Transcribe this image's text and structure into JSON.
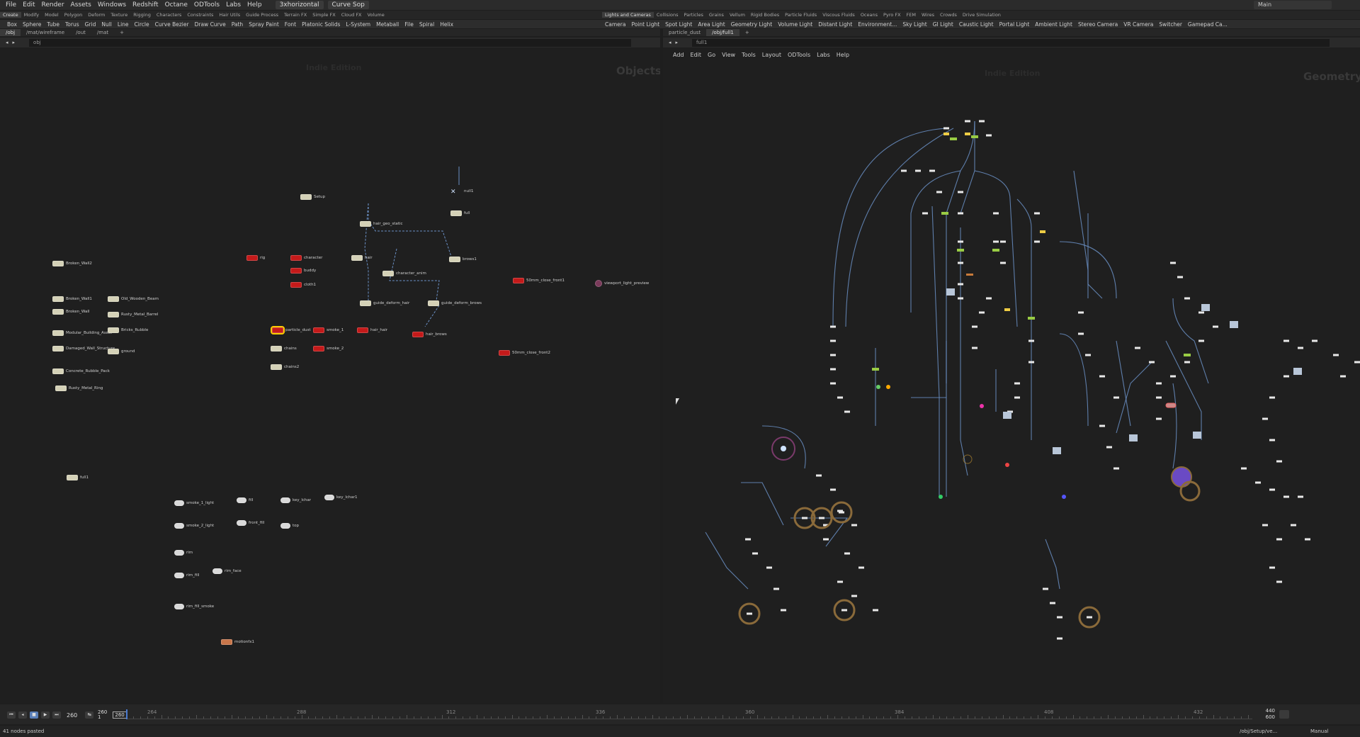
{
  "menubar": {
    "items": [
      "File",
      "Edit",
      "Render",
      "Assets",
      "Windows",
      "Redshift",
      "Octane",
      "ODTools",
      "Labs",
      "Help"
    ],
    "desktop": "3xhorizontal",
    "context": "Curve Sop",
    "main_workspace": "Main"
  },
  "shelf": {
    "tabs_left": [
      "Create",
      "Modify",
      "Model",
      "Polygon",
      "Deform",
      "Texture",
      "Rigging",
      "Characters",
      "Constraints",
      "Hair Utils",
      "Guide Process",
      "Terrain FX",
      "Simple FX",
      "Cloud FX",
      "Volume"
    ],
    "tabs_right": [
      "Lights and Cameras",
      "Collisions",
      "Particles",
      "Grains",
      "Vellum",
      "Rigid Bodies",
      "Particle Fluids",
      "Viscous Fluids",
      "Oceans",
      "Pyro FX",
      "FEM",
      "Wires",
      "Crowds",
      "Drive Simulation"
    ],
    "tools_left": [
      "Box",
      "Sphere",
      "Tube",
      "Torus",
      "Grid",
      "Null",
      "Line",
      "Circle",
      "Curve Bezier",
      "Draw Curve",
      "Path",
      "Spray Paint",
      "Font",
      "Platonic Solids",
      "L-System",
      "Metaball",
      "File",
      "Spiral",
      "Helix"
    ],
    "tools_right": [
      "Camera",
      "Point Light",
      "Spot Light",
      "Area Light",
      "Geometry Light",
      "Volume Light",
      "Distant Light",
      "Environment...",
      "Sky Light",
      "GI Light",
      "Caustic Light",
      "Portal Light",
      "Ambient Light",
      "Stereo Camera",
      "VR Camera",
      "Switcher",
      "Gamepad Ca..."
    ]
  },
  "left_pane": {
    "tabs": [
      "/obj",
      "/mat/wireframe",
      "/out",
      "/mat"
    ],
    "path": "obj",
    "watermark": "Indie Edition",
    "context_label": "Objects",
    "nodes": [
      {
        "label": "Setup",
        "type": "geo"
      },
      {
        "label": "null1",
        "type": "null"
      },
      {
        "label": "full",
        "type": "geo"
      },
      {
        "label": "hair_geo_static",
        "type": "geo"
      },
      {
        "label": "Broken_Wall2",
        "type": "geo"
      },
      {
        "label": "rig",
        "type": "red"
      },
      {
        "label": "character",
        "type": "red"
      },
      {
        "label": "buddy",
        "type": "red"
      },
      {
        "label": "cloth1",
        "type": "red"
      },
      {
        "label": "hair",
        "type": "geo"
      },
      {
        "label": "character_anim",
        "type": "geo"
      },
      {
        "label": "brows1",
        "type": "geo"
      },
      {
        "label": "50mm_close_front1",
        "type": "red"
      },
      {
        "label": "viewport_light_preview",
        "type": "light"
      },
      {
        "label": "Broken_Wall1",
        "type": "geo"
      },
      {
        "label": "Old_Wooden_Beam",
        "type": "geo"
      },
      {
        "label": "Broken_Wall",
        "type": "geo"
      },
      {
        "label": "Rusty_Metal_Barrel",
        "type": "geo"
      },
      {
        "label": "guide_deform_hair",
        "type": "geo"
      },
      {
        "label": "guide_deform_brows",
        "type": "geo"
      },
      {
        "label": "Modular_Building_Asset",
        "type": "geo"
      },
      {
        "label": "Bricks_Rubble",
        "type": "geo"
      },
      {
        "label": "particle_dust",
        "type": "red"
      },
      {
        "label": "smoke_1",
        "type": "red"
      },
      {
        "label": "hair_hair",
        "type": "red"
      },
      {
        "label": "hair_brows",
        "type": "red"
      },
      {
        "label": "Damaged_Wall_Structure",
        "type": "geo"
      },
      {
        "label": "ground",
        "type": "geo"
      },
      {
        "label": "chains",
        "type": "geo"
      },
      {
        "label": "smoke_2",
        "type": "red"
      },
      {
        "label": "50mm_close_front2",
        "type": "red"
      },
      {
        "label": "chains2",
        "type": "geo"
      },
      {
        "label": "Concrete_Rubble_Pack",
        "type": "geo"
      },
      {
        "label": "Rusty_Metal_Ring",
        "type": "geo"
      },
      {
        "label": "full1",
        "type": "geo"
      },
      {
        "label": "smoke_1_light",
        "type": "light"
      },
      {
        "label": "fill",
        "type": "light"
      },
      {
        "label": "key_lchar",
        "type": "light"
      },
      {
        "label": "key_lchar1",
        "type": "light"
      },
      {
        "label": "smoke_2_light",
        "type": "light"
      },
      {
        "label": "front_fill",
        "type": "light"
      },
      {
        "label": "top",
        "type": "light"
      },
      {
        "label": "rim",
        "type": "light"
      },
      {
        "label": "rim_fill",
        "type": "light"
      },
      {
        "label": "rim_face",
        "type": "light"
      },
      {
        "label": "rim_fill_smoke",
        "type": "light"
      },
      {
        "label": "motionfx1",
        "type": "orange"
      }
    ]
  },
  "right_pane": {
    "tabs": [
      "particle_dust",
      "/obj/full1"
    ],
    "path": "full1",
    "menu": [
      "Add",
      "Edit",
      "Go",
      "View",
      "Tools",
      "Layout",
      "ODTools",
      "Labs",
      "Help"
    ],
    "watermark": "Indie Edition",
    "context_label": "Geometry"
  },
  "timeline": {
    "current_frame": "260",
    "frame_field": "260",
    "range_start": "260",
    "range_step": "1",
    "ticks": [
      "264",
      "288",
      "312",
      "336",
      "360",
      "384",
      "408",
      "432"
    ],
    "end_frame_top": "440",
    "end_frame_bottom": "600"
  },
  "status": {
    "message": "41 nodes pasted",
    "node_path": "/obj/Setup/ve...",
    "mode": "Manual"
  },
  "colors": {
    "background": "#1f1f1f",
    "node_default": "#d4d1b7",
    "node_red": "#c41a1a",
    "wire": "#6a8fc4",
    "selection": "#ffcc00"
  }
}
